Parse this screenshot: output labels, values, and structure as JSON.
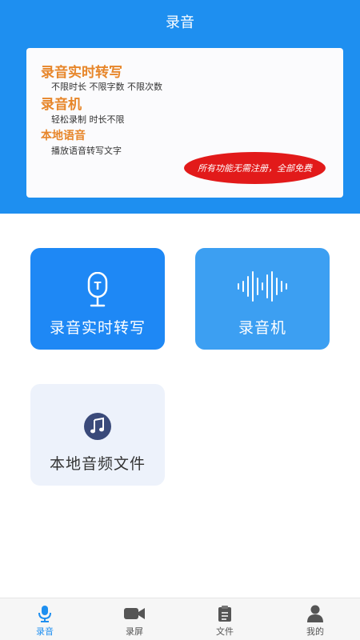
{
  "header": {
    "title": "录音"
  },
  "banner": {
    "features": [
      {
        "title": "录音实时转写",
        "desc": "不限时长  不限字数  不限次数"
      },
      {
        "title": "录音机",
        "desc": "轻松录制  时长不限"
      },
      {
        "title": "本地语音",
        "desc": "播放语音转写文字"
      }
    ],
    "promo": "所有功能无需注册，全部免费"
  },
  "tiles": [
    {
      "label": "录音实时转写",
      "icon": "mic-t-icon"
    },
    {
      "label": "录音机",
      "icon": "waveform-icon"
    },
    {
      "label": "本地音频文件",
      "icon": "music-note-icon"
    }
  ],
  "tabbar": {
    "items": [
      {
        "label": "录音",
        "icon": "mic-icon",
        "active": true
      },
      {
        "label": "录屏",
        "icon": "video-camera-icon"
      },
      {
        "label": "文件",
        "icon": "clipboard-icon"
      },
      {
        "label": "我的",
        "icon": "person-icon"
      }
    ]
  },
  "colors": {
    "primary": "#1e8ff0",
    "accent_orange": "#e7862a",
    "promo_red": "#e21a1a",
    "tile_light": "#edf2fb"
  }
}
